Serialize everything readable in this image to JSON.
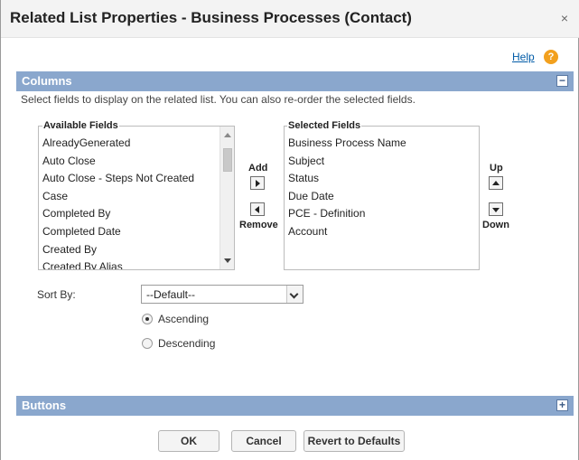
{
  "dialog": {
    "title": "Related List Properties - Business Processes (Contact)",
    "close_symbol": "×",
    "help_label": "Help",
    "help_symbol": "?"
  },
  "columns": {
    "header": "Columns",
    "toggle_symbol": "−",
    "description": "Select fields to display on the related list. You can also re-order the selected fields.",
    "available_heading": "Available Fields",
    "available_fields": [
      "AlreadyGenerated",
      "Auto Close",
      "Auto Close - Steps Not Created",
      "Case",
      "Completed By",
      "Completed Date",
      "Created By",
      "Created By Alias"
    ],
    "selected_heading": "Selected Fields",
    "selected_fields": [
      "Business Process Name",
      "Subject",
      "Status",
      "Due Date",
      "PCE - Definition",
      "Account"
    ],
    "add_label": "Add",
    "remove_label": "Remove",
    "up_label": "Up",
    "down_label": "Down"
  },
  "sort": {
    "label": "Sort By:",
    "selected": "--Default--",
    "options": [
      {
        "label": "Ascending",
        "checked": true
      },
      {
        "label": "Descending",
        "checked": false
      }
    ]
  },
  "buttons_section": {
    "header": "Buttons",
    "toggle_symbol": "+"
  },
  "footer": {
    "ok": "OK",
    "cancel": "Cancel",
    "revert": "Revert to Defaults"
  },
  "colors": {
    "section_header": "#8aa7cd",
    "link": "#015ba7",
    "help_icon": "#f2a01e"
  }
}
